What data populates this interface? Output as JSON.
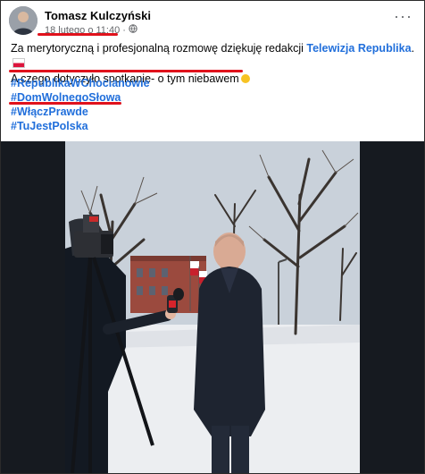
{
  "post": {
    "author": "Tomasz Kulczyński",
    "date": "18 lutego o 11:40",
    "privacy_icon": "globe-icon",
    "more_icon": "more-options-icon",
    "text_part1": "Za merytoryczną i profesjonalną rozmowę dziękuję redakcji ",
    "text_link": "Telewizja Republika",
    "text_part2": ". ",
    "text_line2": "A czego dotyczyło spotkanie- o tym niebawem",
    "hashtags": [
      "#RepublikaWChocianowie",
      "#DomWolnegoSlowa",
      "#WłączPrawdę",
      "#TuJestPolska"
    ]
  },
  "hashtag_display": [
    "#RepublikaWChocianowie",
    "#DomWolnegoSłowa",
    "#WłączPrawde",
    "#TuJestPolska"
  ],
  "colors": {
    "link": "#216fdb",
    "underline": "#e0121c",
    "meta": "#65676b"
  }
}
